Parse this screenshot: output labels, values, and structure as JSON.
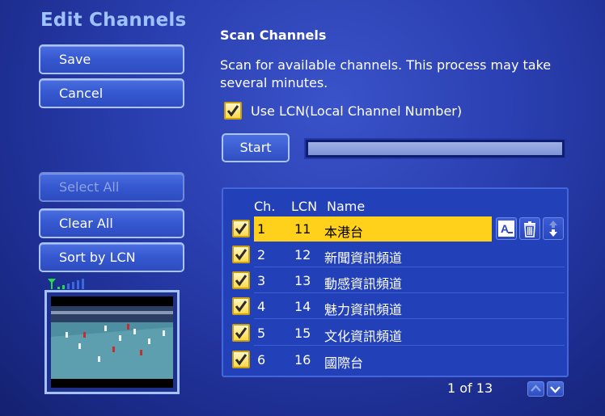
{
  "page": {
    "title": "Edit Channels"
  },
  "sidebar": {
    "save_label": "Save",
    "cancel_label": "Cancel",
    "select_all_label": "Select All",
    "clear_all_label": "Clear All",
    "sort_label": "Sort by LCN"
  },
  "scan": {
    "title": "Scan Channels",
    "description": "Scan for available channels. This process may take several minutes.",
    "use_lcn_label": "Use LCN(Local Channel Number)",
    "use_lcn_checked": true,
    "start_label": "Start"
  },
  "list": {
    "headers": {
      "ch": "Ch.",
      "lcn": "LCN",
      "name": "Name"
    },
    "rows": [
      {
        "ch": "1",
        "lcn": "11",
        "name": "本港台",
        "checked": true,
        "selected": true
      },
      {
        "ch": "2",
        "lcn": "12",
        "name": "新聞資訊頻道",
        "checked": true,
        "selected": false
      },
      {
        "ch": "3",
        "lcn": "13",
        "name": "動感資訊頻道",
        "checked": true,
        "selected": false
      },
      {
        "ch": "4",
        "lcn": "14",
        "name": "魅力資訊頻道",
        "checked": true,
        "selected": false
      },
      {
        "ch": "5",
        "lcn": "15",
        "name": "文化資訊頻道",
        "checked": true,
        "selected": false
      },
      {
        "ch": "6",
        "lcn": "16",
        "name": "國際台",
        "checked": true,
        "selected": false
      }
    ],
    "pager": "1 of 13"
  },
  "icons": {
    "rename": "rename-icon",
    "delete": "trash-icon",
    "move": "move-up-down-icon",
    "signal": "signal-strength-icon",
    "page_up": "chevron-up-icon",
    "page_down": "chevron-down-icon"
  },
  "colors": {
    "accent_title": "#9ec2ff",
    "selection": "#ffd11a",
    "background": "#2a3fb0"
  }
}
